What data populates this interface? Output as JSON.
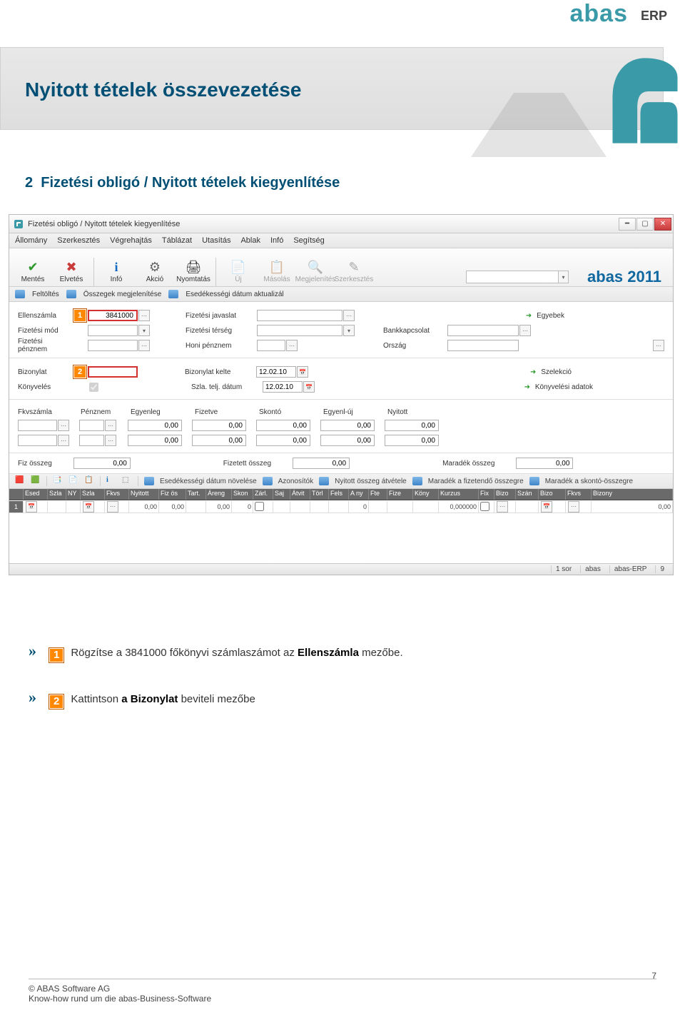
{
  "brand": {
    "a": "abas",
    "erp": "ERP"
  },
  "page_title": "Nyitott tételek összevezetése",
  "subtitle_num": "2",
  "subtitle": "Fizetési obligó / Nyitott tételek kiegyenlítése",
  "window": {
    "title": "Fizetési obligó / Nyitott tételek kiegyenlítése",
    "menubar": [
      "Állomány",
      "Szerkesztés",
      "Végrehajtás",
      "Táblázat",
      "Utasítás",
      "Ablak",
      "Infó",
      "Segítség"
    ],
    "toolbar": {
      "save": "Mentés",
      "discard": "Elvetés",
      "info": "Infó",
      "action": "Akció",
      "print": "Nyomtatás",
      "new_": "Új",
      "copy": "Másolás",
      "view": "Megjelenítés",
      "edit": "Szerkesztés",
      "abas": "abas 2011"
    },
    "subbar": [
      "Feltöltés",
      "Összegek megjelenítése",
      "Esedékességi dátum aktualizál"
    ],
    "panel1": {
      "ellenszmla_lbl": "Ellenszámla",
      "ellenszmla_val": "3841000",
      "fizjav_lbl": "Fizetési javaslat",
      "egyebek_lbl": "Egyebek",
      "fizmod_lbl": "Fizetési mód",
      "fizters_lbl": "Fizetési térség",
      "bank_lbl": "Bankkapcsolat",
      "fizpenz_lbl": "Fizetési pénznem",
      "honipenz_lbl": "Honi pénznem",
      "orszag_lbl": "Ország"
    },
    "panel2": {
      "bizonylat_lbl": "Bizonylat",
      "bizkelte_lbl": "Bizonylat kelte",
      "bizkelte_val": "12.02.10",
      "szelekcio": "Szelekció",
      "konyveles_lbl": "Könyvelés",
      "szla_lbl": "Szla. telj. dátum",
      "szla_val": "12.02.10",
      "konyvadatok": "Könyvelési adatok"
    },
    "totals": {
      "headers": [
        "Fkvszámla",
        "Pénznem",
        "Egyenleg",
        "Fizetve",
        "Skontó",
        "Egyenl-új",
        "Nyitott"
      ],
      "row1": [
        "",
        "",
        "0,00",
        "0,00",
        "0,00",
        "0,00",
        "0,00"
      ],
      "row2": [
        "",
        "",
        "0,00",
        "0,00",
        "0,00",
        "0,00",
        "0,00"
      ]
    },
    "sums": {
      "fiz_lbl": "Fiz összeg",
      "fiz_val": "0,00",
      "fizetett_lbl": "Fizetett összeg",
      "fizetett_val": "0,00",
      "maradek_lbl": "Maradék összeg",
      "maradek_val": "0,00"
    },
    "midbar": [
      "Esedékességi dátum növelése",
      "Azonosítók",
      "Nyitott összeg átvétele",
      "Maradék a fizetendő összegre",
      "Maradék a skontó-összegre"
    ],
    "grid": {
      "headers": [
        "",
        "Esed",
        "Szla",
        "NY",
        "Szla",
        "Fkvs",
        "Nyitott",
        "Fiz ös",
        "Tart.",
        "Áreng",
        "Skon",
        "Zárl.",
        "Saj",
        "Átvit",
        "Törl",
        "Fels",
        "A ny",
        "Fte",
        "Fize",
        "Köny",
        "Kurzus",
        "Fix",
        "Bizo",
        "Szán",
        "Bizo",
        "Fkvs",
        "Bizony"
      ],
      "row": [
        "1",
        "",
        "",
        "",
        "",
        "",
        "0,00",
        "0,00",
        "",
        "0,00",
        "0",
        "",
        "",
        "",
        "",
        "",
        "0",
        "",
        "",
        "",
        "0,000000",
        "",
        "",
        "",
        "",
        "",
        "0,00"
      ]
    },
    "status": [
      "1 sor",
      "abas",
      "abas-ERP",
      "9"
    ]
  },
  "instructions": {
    "a_pre": "Rögzítse a ",
    "a_num": "3841000",
    "a_mid": " főkönyvi számlaszámot az ",
    "a_bold": "Ellenszámla",
    "a_post": " mezőbe.",
    "b_pre": "Kattintson ",
    "b_bold": "a Bizonylat",
    "b_post": " beviteli mezőbe"
  },
  "footer": {
    "copyright": "© ABAS Software AG",
    "knowhow": "Know-how rund um die abas-Business-Software",
    "page": "7"
  },
  "callout1": "1",
  "callout2": "2"
}
